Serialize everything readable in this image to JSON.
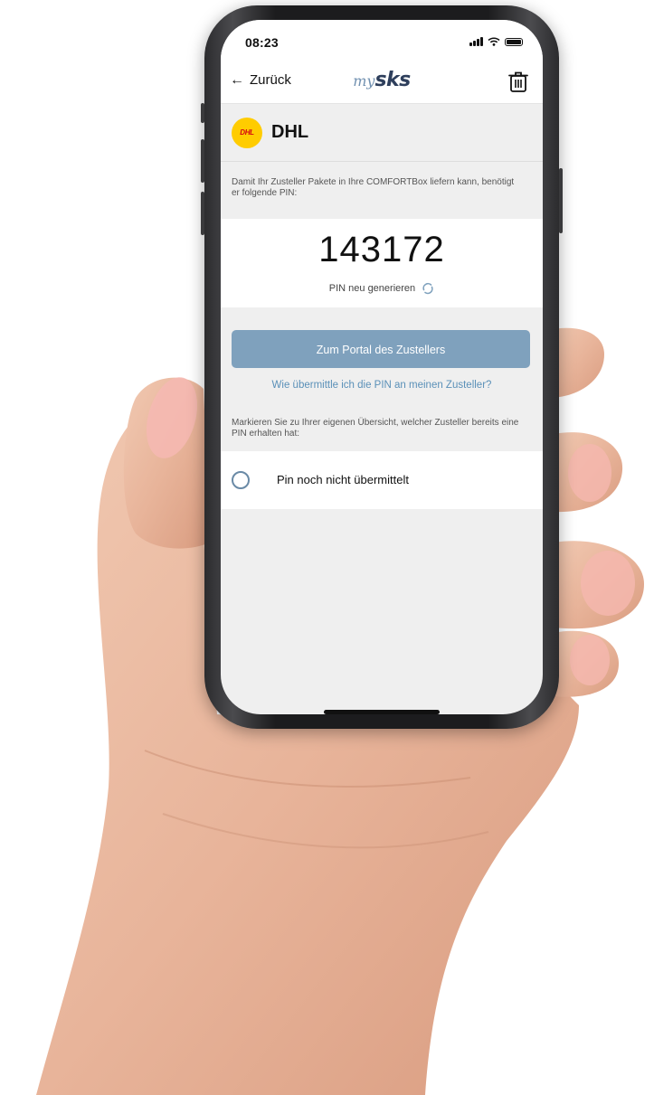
{
  "status_bar": {
    "time": "08:23"
  },
  "nav": {
    "back_label": "Zurück",
    "logo_prefix": "my",
    "logo_main": "sks"
  },
  "carrier": {
    "name": "DHL",
    "logo_text": "DHL"
  },
  "instructions": "Damit Ihr Zusteller Pakete in Ihre COMFORTBox liefern kann, benötigt er folgende PIN:",
  "pin": {
    "value": "143172",
    "regenerate_label": "PIN neu generieren"
  },
  "portal_button_label": "Zum Portal des Zustellers",
  "help_link": "Wie übermittle ich die PIN an meinen Zusteller?",
  "mark_instructions": "Markieren Sie zu Ihrer eigenen Übersicht, welcher Zusteller bereits eine PIN erhalten hat:",
  "pin_status_label": "Pin noch nicht übermittelt",
  "colors": {
    "accent": "#7fa1bd",
    "link": "#5a90b8",
    "dhl_yellow": "#ffcc00",
    "dhl_red": "#d40511",
    "brand_dark": "#2e3f5c"
  }
}
